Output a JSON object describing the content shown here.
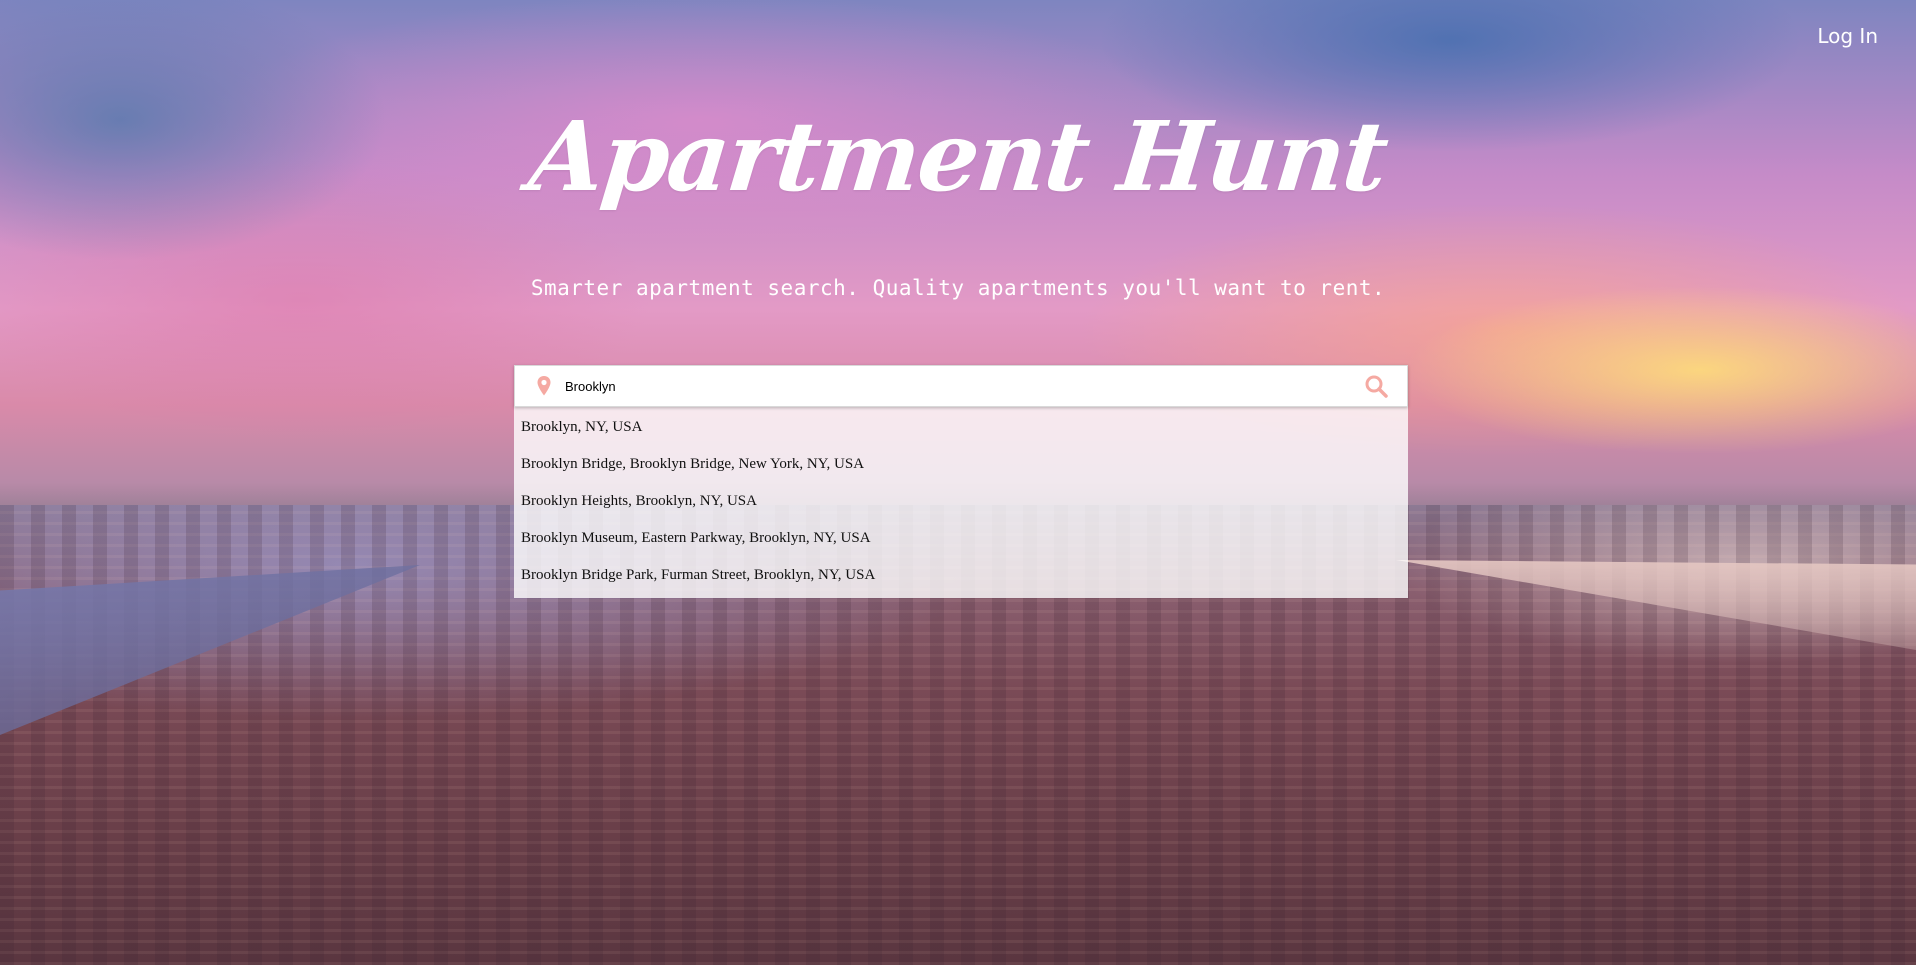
{
  "header": {
    "login_label": "Log In"
  },
  "hero": {
    "logo_text": "Apartment Hunt",
    "tagline": "Smarter apartment search. Quality apartments you'll want to rent."
  },
  "search": {
    "value": "Brooklyn",
    "placeholder": "",
    "pin_icon": "map-pin-icon",
    "search_icon": "magnifier-icon",
    "icon_color": "#f5a9a2",
    "suggestions": [
      "Brooklyn, NY, USA",
      "Brooklyn Bridge, Brooklyn Bridge, New York, NY, USA",
      "Brooklyn Heights, Brooklyn, NY, USA",
      "Brooklyn Museum, Eastern Parkway, Brooklyn, NY, USA",
      "Brooklyn Bridge Park, Furman Street, Brooklyn, NY, USA"
    ]
  }
}
